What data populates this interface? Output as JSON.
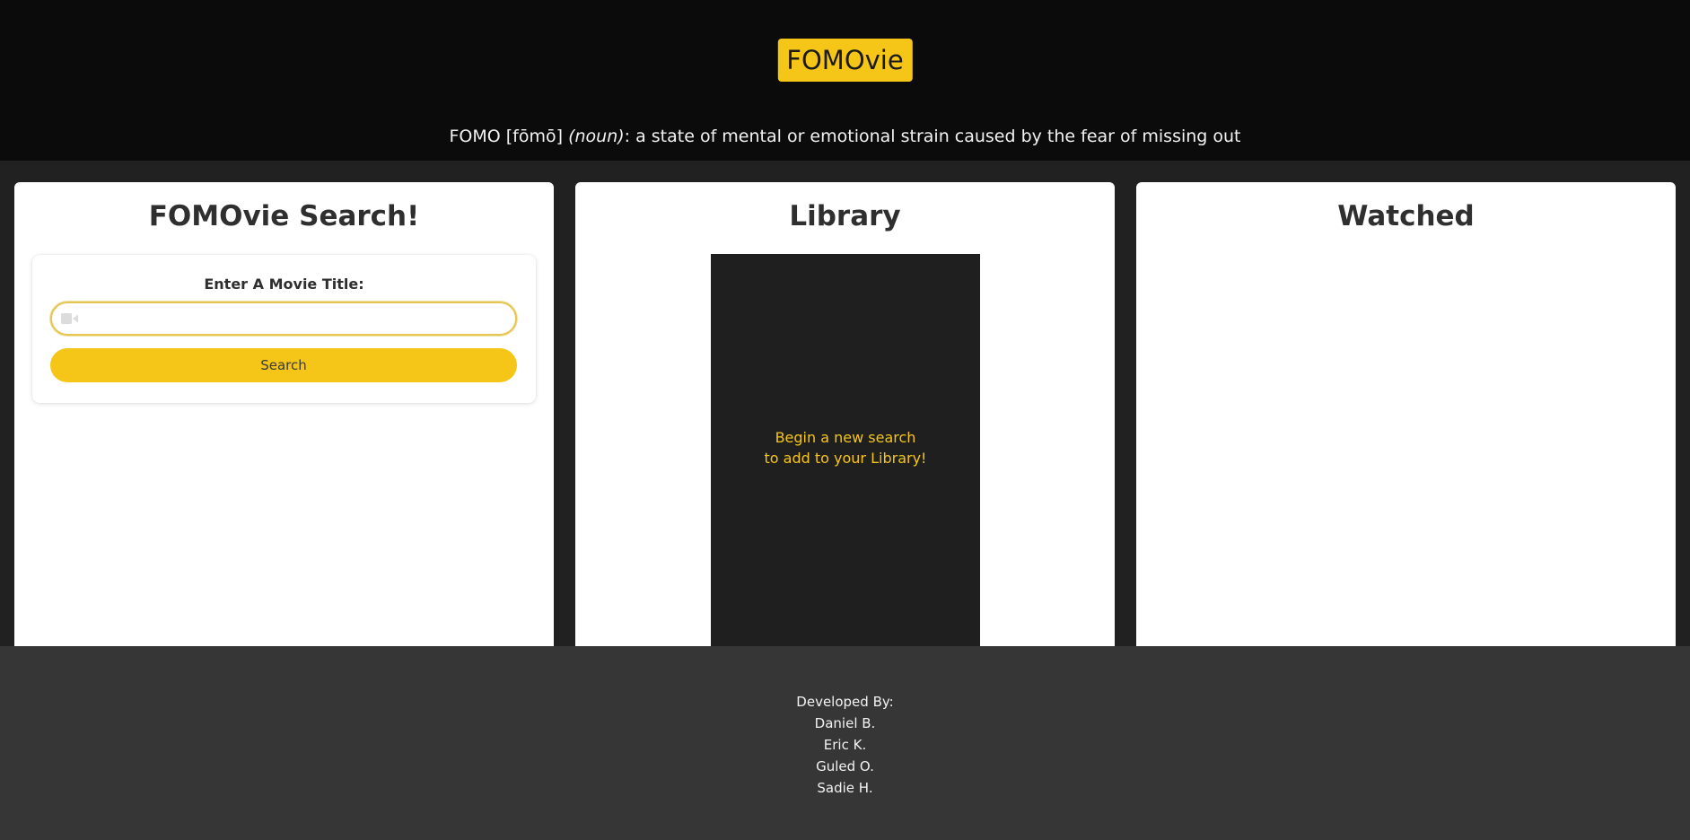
{
  "header": {
    "logo": "FOMOvie",
    "tagline_term": "FOMO [fōmō]",
    "tagline_pos": "(noun)",
    "tagline_definition": ": a state of mental or emotional strain caused by the fear of missing out"
  },
  "search_card": {
    "title": "FOMOvie Search!",
    "label": "Enter A Movie Title:",
    "input_value": "",
    "input_icon": "video-camera-icon",
    "button_label": "Search"
  },
  "library_card": {
    "title": "Library",
    "message_line1": "Begin a new search",
    "message_line2": "to add to your Library!"
  },
  "watched_card": {
    "title": "Watched"
  },
  "footer": {
    "heading": "Developed By:",
    "developers": [
      "Daniel B.",
      "Eric K.",
      "Guled O.",
      "Sadie H."
    ]
  },
  "colors": {
    "accent": "#f5c518",
    "header_bg": "#0b0b0b",
    "body_bg": "#212121",
    "footer_bg": "#363636"
  }
}
